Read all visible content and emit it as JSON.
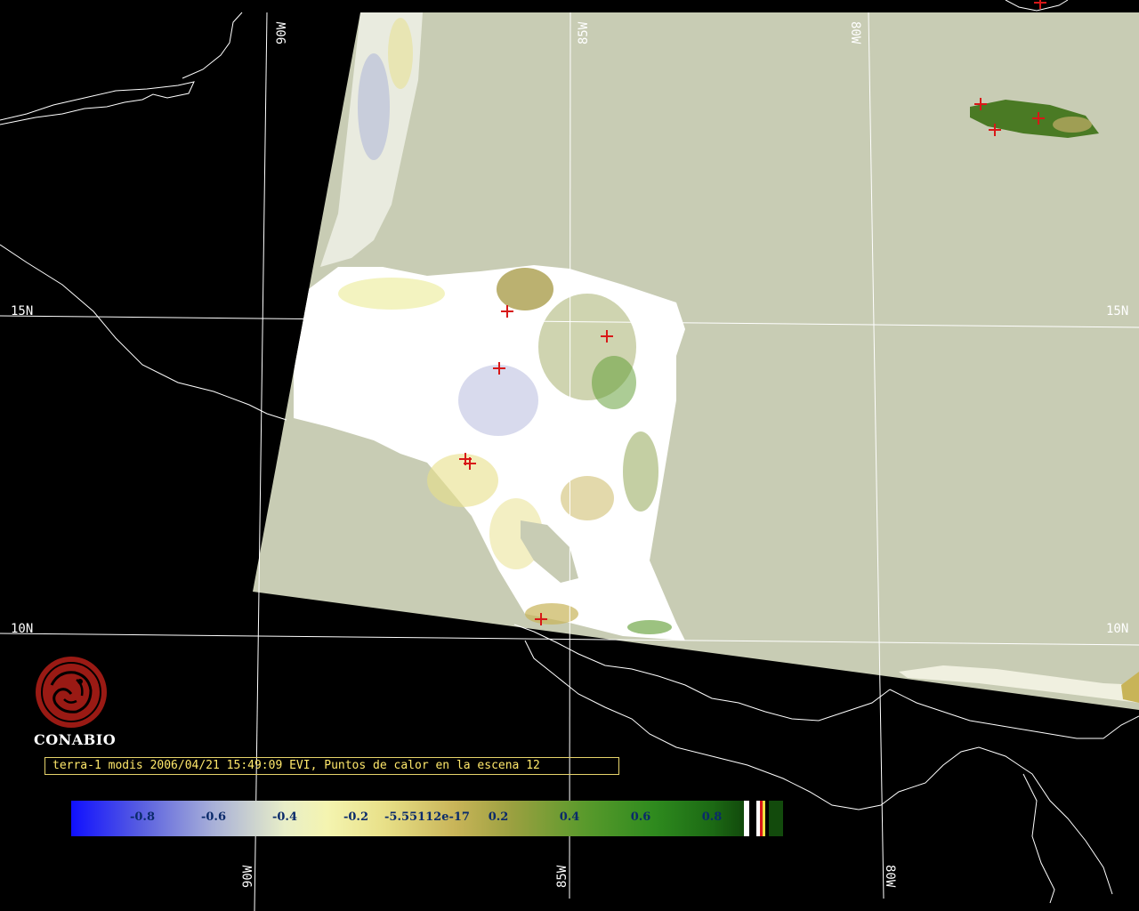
{
  "map": {
    "lat_labels": [
      "15N",
      "10N"
    ],
    "lon_labels_top": [
      "90W",
      "85W",
      "80W"
    ],
    "lon_labels_bottom": [
      "90W",
      "85W",
      "80W"
    ],
    "colors": {
      "background": "#000000",
      "swath": "#c8ccb4",
      "coastline": "#ffffff",
      "graticule": "#ffffff",
      "hotspot": "#d81818"
    }
  },
  "logo": {
    "name": "CONABIO",
    "color": "#9a1a14"
  },
  "caption": {
    "text": "terra-1 modis 2006/04/21 15:49:09 EVI, Puntos de calor en la escena 12"
  },
  "colorbar": {
    "ticks": [
      "-0.8",
      "-0.6",
      "-0.4",
      "-0.2",
      "-5.55112e-17",
      "0.2",
      "0.4",
      "0.6",
      "0.8"
    ]
  }
}
